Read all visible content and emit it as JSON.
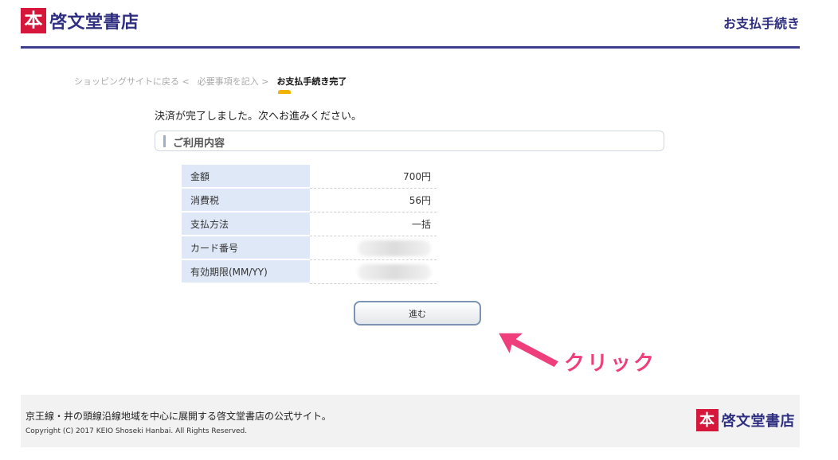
{
  "header": {
    "logo_mark": "本",
    "logo_text": "啓文堂書店",
    "page_title": "お支払手続き"
  },
  "breadcrumb": {
    "items": [
      "ショッピングサイトに戻る <",
      "必要事項を記入 >"
    ],
    "current": "お支払手続き完了"
  },
  "main": {
    "message": "決済が完了しました。次へお進みください。",
    "section_title": "ご利用内容",
    "rows": [
      {
        "label": "金額",
        "value": "700円"
      },
      {
        "label": "消費税",
        "value": "56円"
      },
      {
        "label": "支払方法",
        "value": "一括"
      },
      {
        "label": "カード番号",
        "value": ""
      },
      {
        "label": "有効期限(MM/YY)",
        "value": ""
      }
    ],
    "proceed_label": "進む"
  },
  "annotation": {
    "text": "クリック",
    "color": "#ee3f7c"
  },
  "footer": {
    "description": "京王線・井の頭線沿線地域を中心に展開する啓文堂書店の公式サイト。",
    "copyright": "Copyright (C) 2017 KEIO Shoseki Hanbai. All Rights Reserved.",
    "logo_mark": "本",
    "logo_text": "啓文堂書店"
  }
}
